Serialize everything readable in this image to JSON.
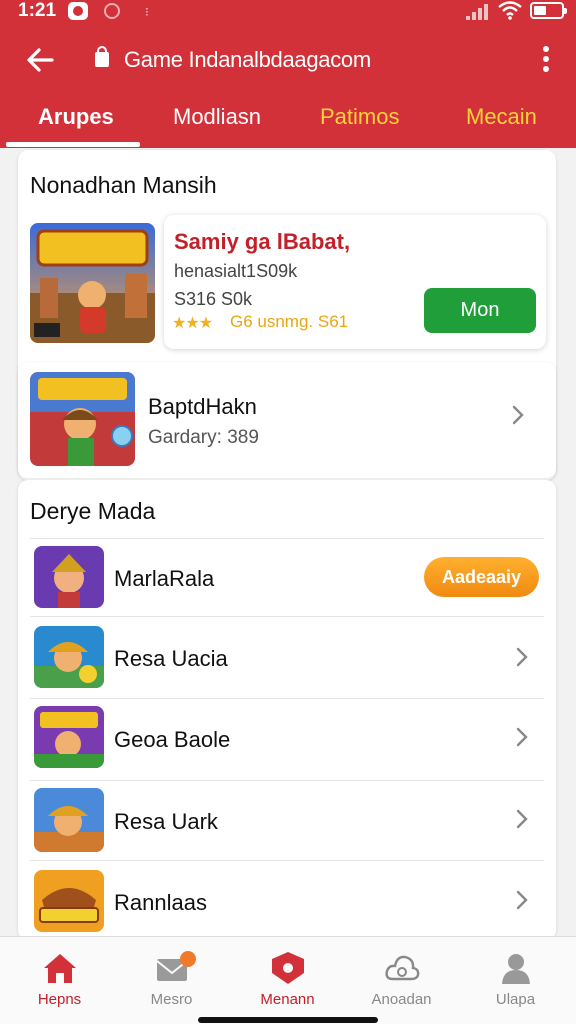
{
  "status_bar": {
    "time": "1:21",
    "icons": [
      "app-notification-icon",
      "vpn-icon",
      "dot-icon",
      "signal-icon",
      "wifi-icon",
      "battery-icon"
    ]
  },
  "browser": {
    "url": "Game Indanalbdaagacom",
    "back_icon": "back-arrow-icon",
    "menu_icon": "kebab-menu-icon"
  },
  "tabs": [
    {
      "label": "Arupes",
      "active": true
    },
    {
      "label": "Modliasn",
      "active": false
    },
    {
      "label": "Patimos",
      "active": false
    },
    {
      "label": "Mecain",
      "active": false
    }
  ],
  "colors": {
    "brand_red": "#d2313a",
    "tab_highlight": "#ffd23a",
    "install_green": "#1f9e3a",
    "badge_orange": "#f08a10"
  },
  "section1": {
    "title": "Nonadhan Mansih",
    "featured": {
      "title": "Samiy ga lBabat,",
      "subtitle": "henasialt1S09k",
      "size": "S316 S0k",
      "stars": "★★★",
      "rating_text": "G6 usnmg. S61",
      "button_label": "Mon"
    },
    "second": {
      "title": "BaptdHakn",
      "subtitle": "Gardary:  389"
    }
  },
  "section2": {
    "title": "Derye Mada",
    "items": [
      {
        "title": "MarlaRala",
        "action": "Aadeaaiy"
      },
      {
        "title": "Resa Uacia"
      },
      {
        "title": "Geoa Baole"
      },
      {
        "title": "Resa Uark"
      },
      {
        "title": "Rannlaas"
      }
    ]
  },
  "bottom_nav": [
    {
      "label": "Hepns",
      "icon": "home-icon",
      "active": true
    },
    {
      "label": "Mesro",
      "icon": "message-icon",
      "active": false
    },
    {
      "label": "Menann",
      "icon": "shield-icon",
      "active": false
    },
    {
      "label": "Anoadan",
      "icon": "cloud-icon",
      "active": false
    },
    {
      "label": "Ulapa",
      "icon": "user-icon",
      "active": false
    }
  ]
}
